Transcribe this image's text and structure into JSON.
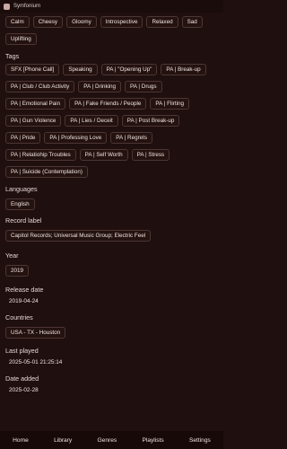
{
  "window": {
    "title": "Symfonium"
  },
  "moods": [
    "Calm",
    "Cheesy",
    "Gloomy",
    "Introspective",
    "Relaxed",
    "Sad",
    "Uplifting"
  ],
  "tags": {
    "title": "Tags",
    "items": [
      "SFX [Phone Call]",
      "Speaking",
      "PA | \"Opening Up\"",
      "PA | Break-up",
      "PA | Club / Club Activity",
      "PA | Drinking",
      "PA | Drugs",
      "PA | Emotional Pain",
      "PA | Fake Friends / People",
      "PA | Flirting",
      "PA | Gun Violence",
      "PA | Lies / Deceit",
      "PA | Post Break-up",
      "PA | Pride",
      "PA | Professing Love",
      "PA | Regrets",
      "PA | Relatiohip Troubles",
      "PA | Self Worth",
      "PA | Stress",
      "PA | Suicide (Contemplation)"
    ]
  },
  "languages": {
    "title": "Languages",
    "items": [
      "English"
    ]
  },
  "record_label": {
    "title": "Record label",
    "items": [
      "Capitol Records; Universal Music Group; Electric Feel"
    ]
  },
  "year": {
    "title": "Year",
    "items": [
      "2019"
    ]
  },
  "release_date": {
    "title": "Release date",
    "value": "2019-04-24"
  },
  "countries": {
    "title": "Countries",
    "items": [
      "USA - TX - Houston"
    ]
  },
  "last_played": {
    "title": "Last played",
    "value": "2025-05-01 21:25:14"
  },
  "date_added": {
    "title": "Date added",
    "value": "2025-02-28"
  },
  "nav": {
    "home": "Home",
    "library": "Library",
    "genres": "Genres",
    "playlists": "Playlists",
    "settings": "Settings"
  }
}
